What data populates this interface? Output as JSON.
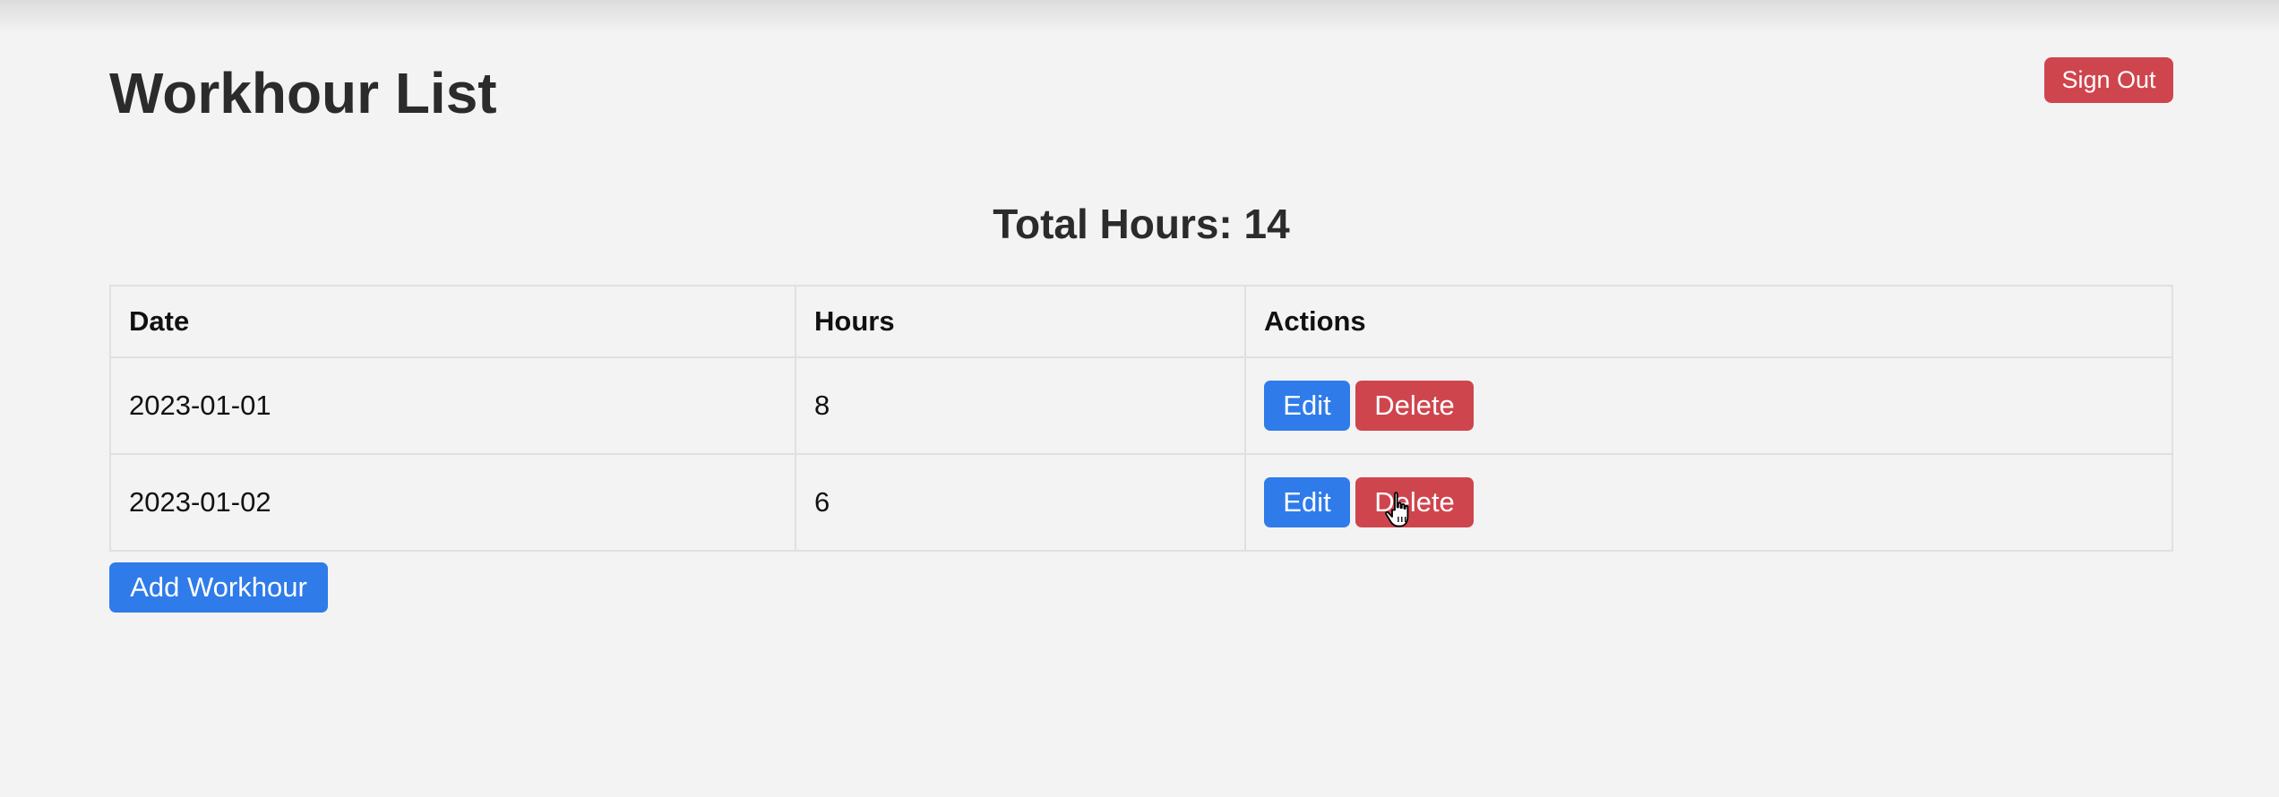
{
  "header": {
    "title": "Workhour List",
    "sign_out_label": "Sign Out"
  },
  "summary": {
    "total_hours_label": "Total Hours: 14"
  },
  "table": {
    "columns": [
      "Date",
      "Hours",
      "Actions"
    ],
    "rows": [
      {
        "date": "2023-01-01",
        "hours": "8",
        "edit_label": "Edit",
        "delete_label": "Delete"
      },
      {
        "date": "2023-01-02",
        "hours": "6",
        "edit_label": "Edit",
        "delete_label": "Delete"
      }
    ]
  },
  "footer": {
    "add_label": "Add Workhour"
  },
  "colors": {
    "primary": "#2f7bea",
    "danger": "#cf454d",
    "background": "#f3f3f3"
  },
  "icons": {
    "cursor": "hand-pointer-icon"
  }
}
